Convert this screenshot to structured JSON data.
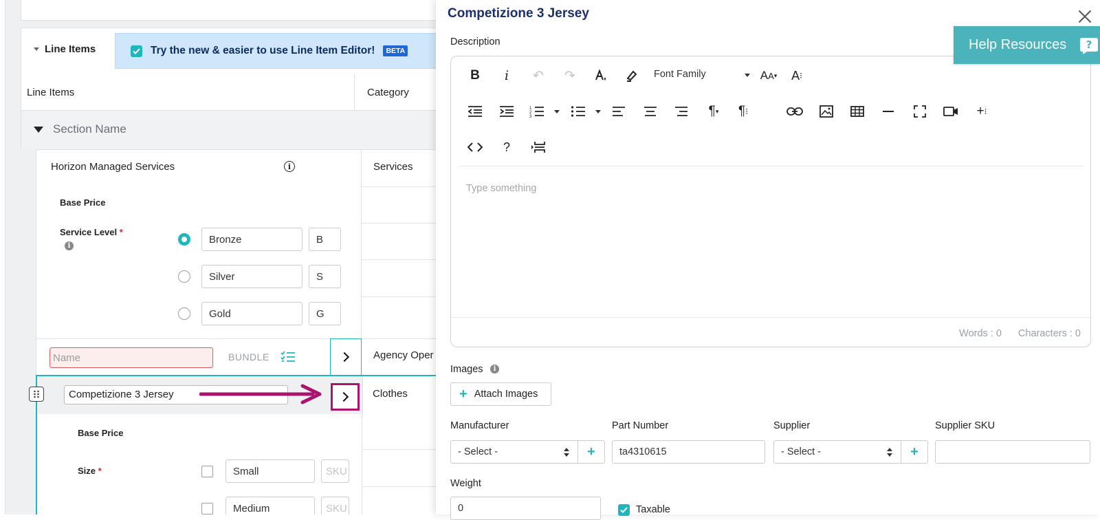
{
  "left": {
    "line_items_toggle": "Line Items",
    "beta_banner": {
      "text": "Try the new & easier to use Line Item Editor!",
      "badge": "BETA"
    },
    "table_headers": {
      "line_items": "Line Items",
      "category": "Category"
    },
    "section_name": "Section Name",
    "item1": {
      "name": "Horizon Managed Services",
      "category": "Services",
      "base_price_label": "Base Price",
      "service_level_label": "Service Level",
      "required_mark": "*",
      "options": [
        {
          "name": "Bronze",
          "sku": "B",
          "selected": true
        },
        {
          "name": "Silver",
          "sku": "S",
          "selected": false
        },
        {
          "name": "Gold",
          "sku": "G",
          "selected": false
        }
      ]
    },
    "bundle_row": {
      "name_placeholder": "Name",
      "bundle_label": "BUNDLE",
      "category": "Agency Oper"
    },
    "item2": {
      "name": "Competizione 3 Jersey",
      "category": "Clothes",
      "base_price_label": "Base Price",
      "size_label": "Size",
      "required_mark": "*",
      "sizes": [
        {
          "name": "Small",
          "sku": "SKU"
        },
        {
          "name": "Medium",
          "sku": "SKU"
        }
      ]
    },
    "annotation_arrow_color": "#a8146e"
  },
  "modal": {
    "title": "Competizione 3 Jersey",
    "description_label": "Description",
    "toolbar": {
      "font_family": "Font Family"
    },
    "editor_placeholder": "Type something",
    "words": "Words : 0",
    "characters": "Characters : 0",
    "images_label": "Images",
    "attach_images": "Attach Images",
    "manufacturer_label": "Manufacturer",
    "manufacturer_value": "- Select -",
    "part_number_label": "Part Number",
    "part_number_value": "ta4310615",
    "supplier_label": "Supplier",
    "supplier_value": "- Select -",
    "supplier_sku_label": "Supplier SKU",
    "supplier_sku_value": "",
    "weight_label": "Weight",
    "weight_value": "0",
    "taxable_label": "Taxable",
    "taxable_checked": true
  },
  "help": {
    "label": "Help Resources"
  },
  "colors": {
    "teal": "#1fb7be",
    "title_navy": "#1a2f6e",
    "beta_blue": "#1f68d6",
    "help_teal": "#4ab3bc",
    "annotation": "#a8146e"
  }
}
